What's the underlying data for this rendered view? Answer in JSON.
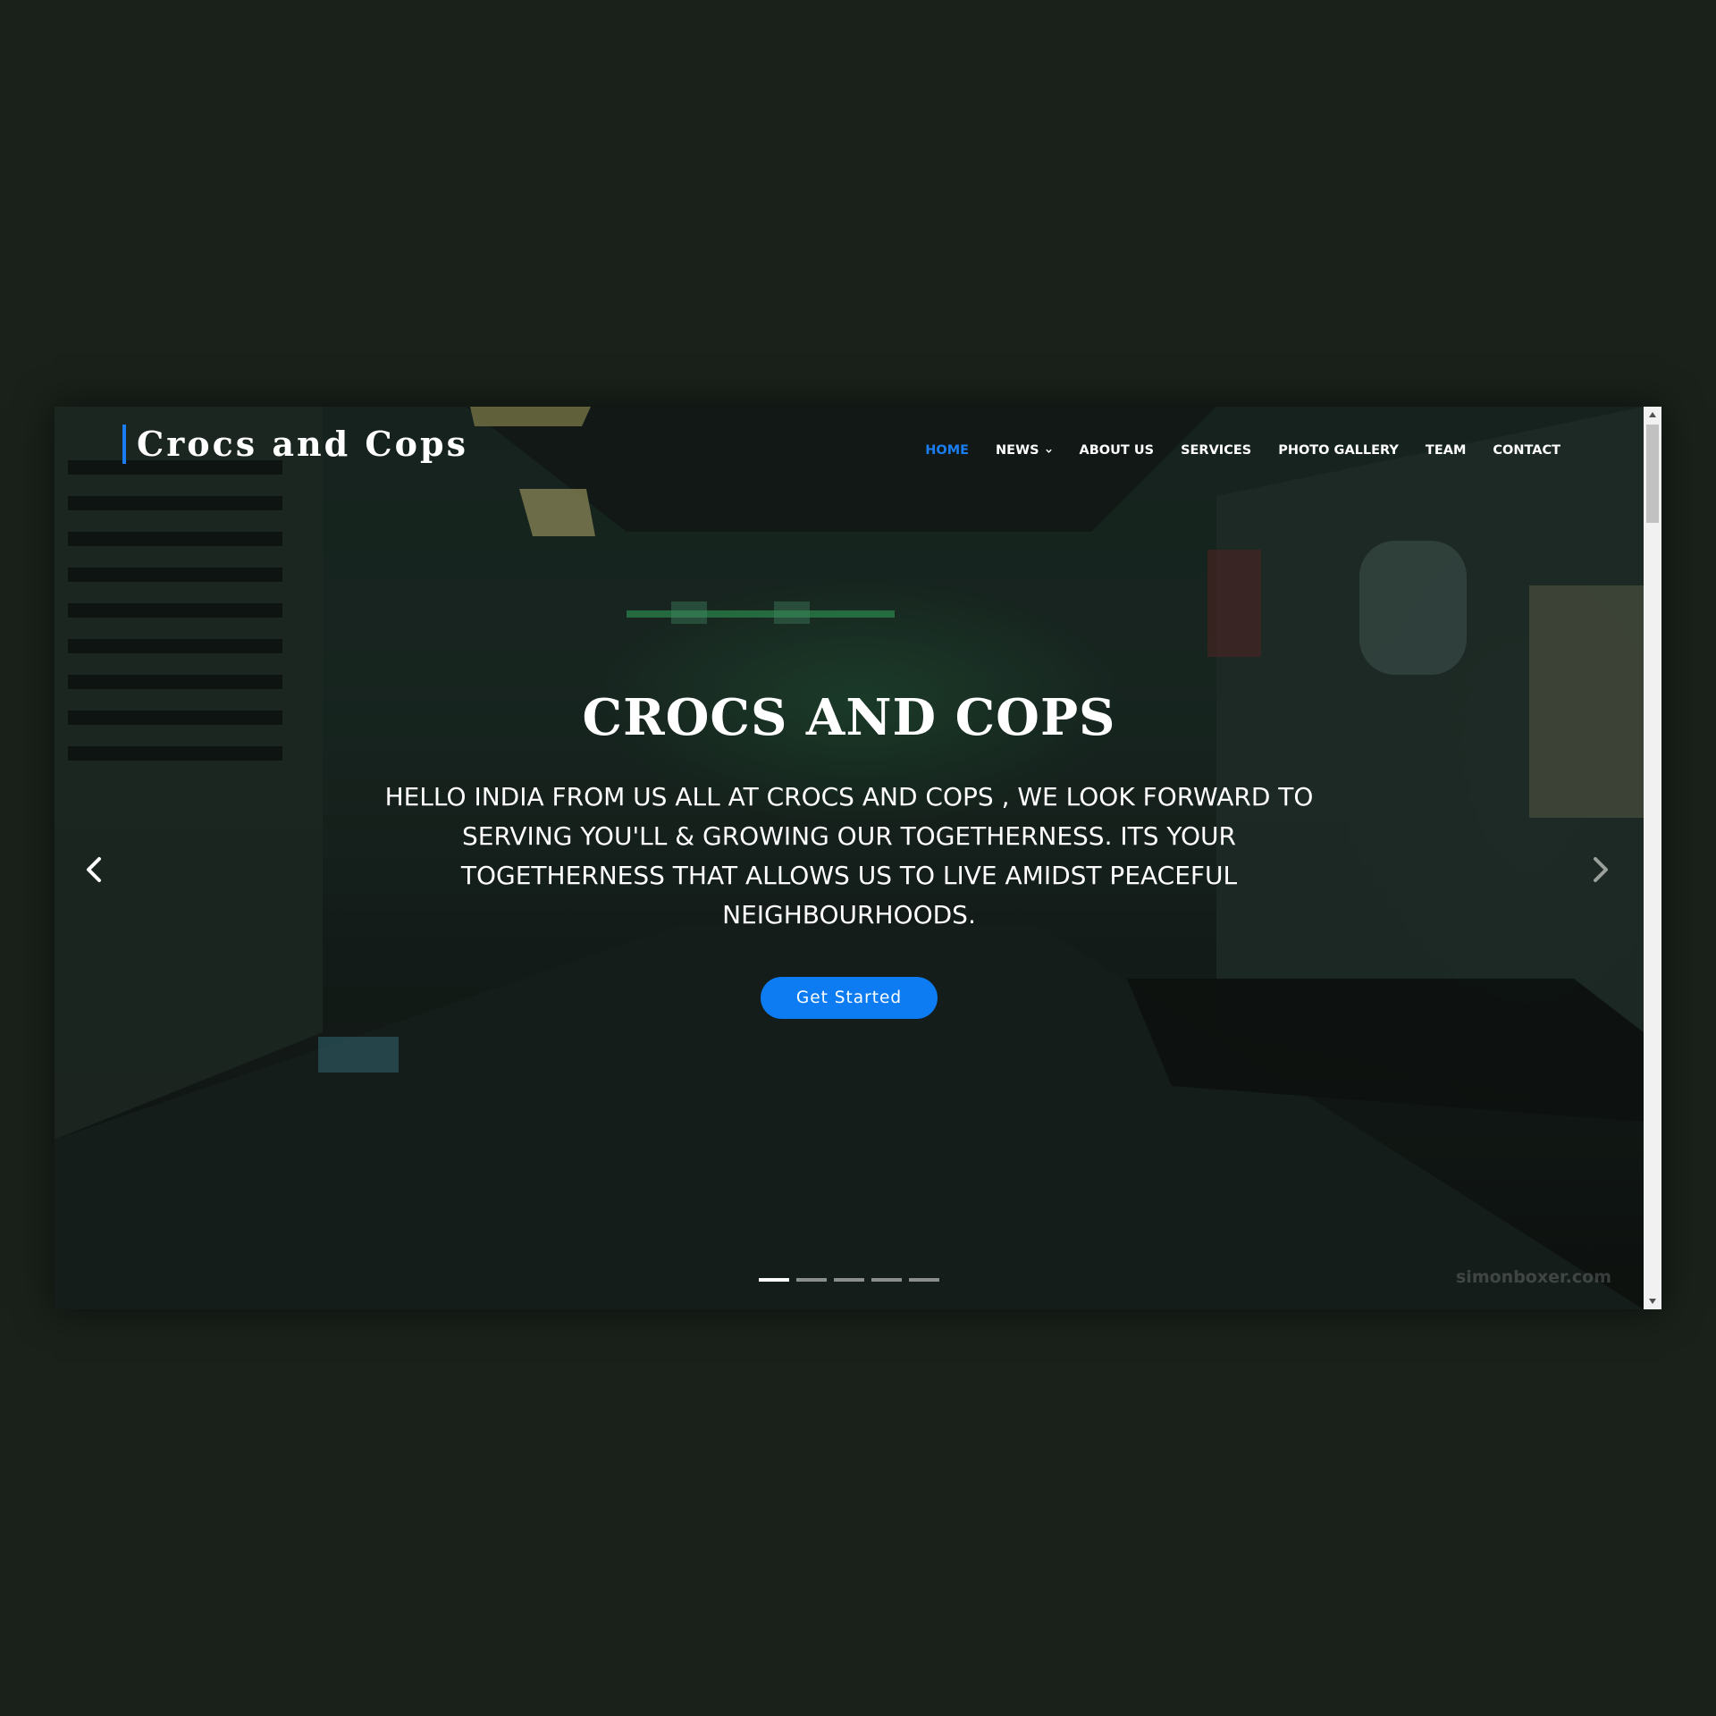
{
  "site": {
    "logo_text": "Crocs and Cops"
  },
  "nav": {
    "items": [
      {
        "label": "HOME",
        "active": true
      },
      {
        "label": "NEWS",
        "dropdown": true
      },
      {
        "label": "ABOUT US"
      },
      {
        "label": "SERVICES"
      },
      {
        "label": "PHOTO GALLERY"
      },
      {
        "label": "TEAM"
      },
      {
        "label": "CONTACT"
      }
    ]
  },
  "hero": {
    "title": "CROCS AND COPS",
    "text": "HELLO INDIA FROM US ALL AT CROCS AND COPS , WE LOOK FORWARD TO SERVING YOU'LL & GROWING OUR TOGETHERNESS. ITS YOUR TOGETHERNESS THAT ALLOWS US TO LIVE AMIDST PEACEFUL NEIGHBOURHOODS.",
    "cta_label": "Get Started",
    "watermark": "simonboxer.com",
    "slide_count": 5,
    "active_slide": 1
  },
  "icons": {
    "prev": "chevron-left-icon",
    "next": "chevron-right-icon",
    "dropdown": "chevron-down-icon"
  },
  "colors": {
    "accent": "#0d7bf2",
    "nav_active": "#1a7ef2",
    "page_background": "#19211a"
  }
}
